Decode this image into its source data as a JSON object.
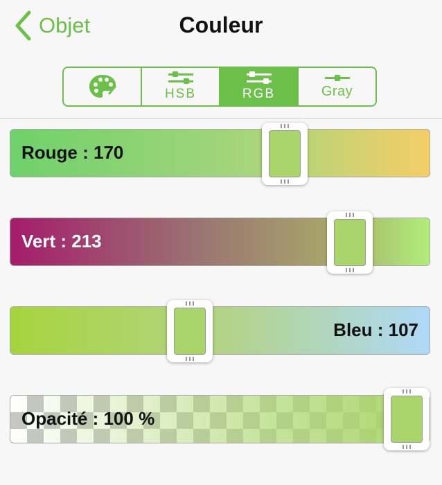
{
  "header": {
    "back_label": "Objet",
    "title": "Couleur"
  },
  "segmented": {
    "tabs": [
      {
        "id": "palette",
        "label": "",
        "icon": "palette-icon"
      },
      {
        "id": "hsb",
        "label": "HSB",
        "icon": "sliders-icon"
      },
      {
        "id": "rgb",
        "label": "RGB",
        "icon": "sliders-icon",
        "selected": true
      },
      {
        "id": "gray",
        "label": "Gray",
        "icon": "slider-icon"
      }
    ]
  },
  "sliders": [
    {
      "name": "red",
      "label": "Rouge : 170",
      "value": 170,
      "max": 255
    },
    {
      "name": "green",
      "label": "Vert : 213",
      "value": 213,
      "max": 255
    },
    {
      "name": "blue",
      "label": "Bleu : 107",
      "value": 107,
      "max": 255
    },
    {
      "name": "opacity",
      "label": "Opacité : 100 %",
      "value": 100,
      "max": 100
    }
  ],
  "colors": {
    "accent": "#6cc04a",
    "current_color": "#aad56b"
  }
}
